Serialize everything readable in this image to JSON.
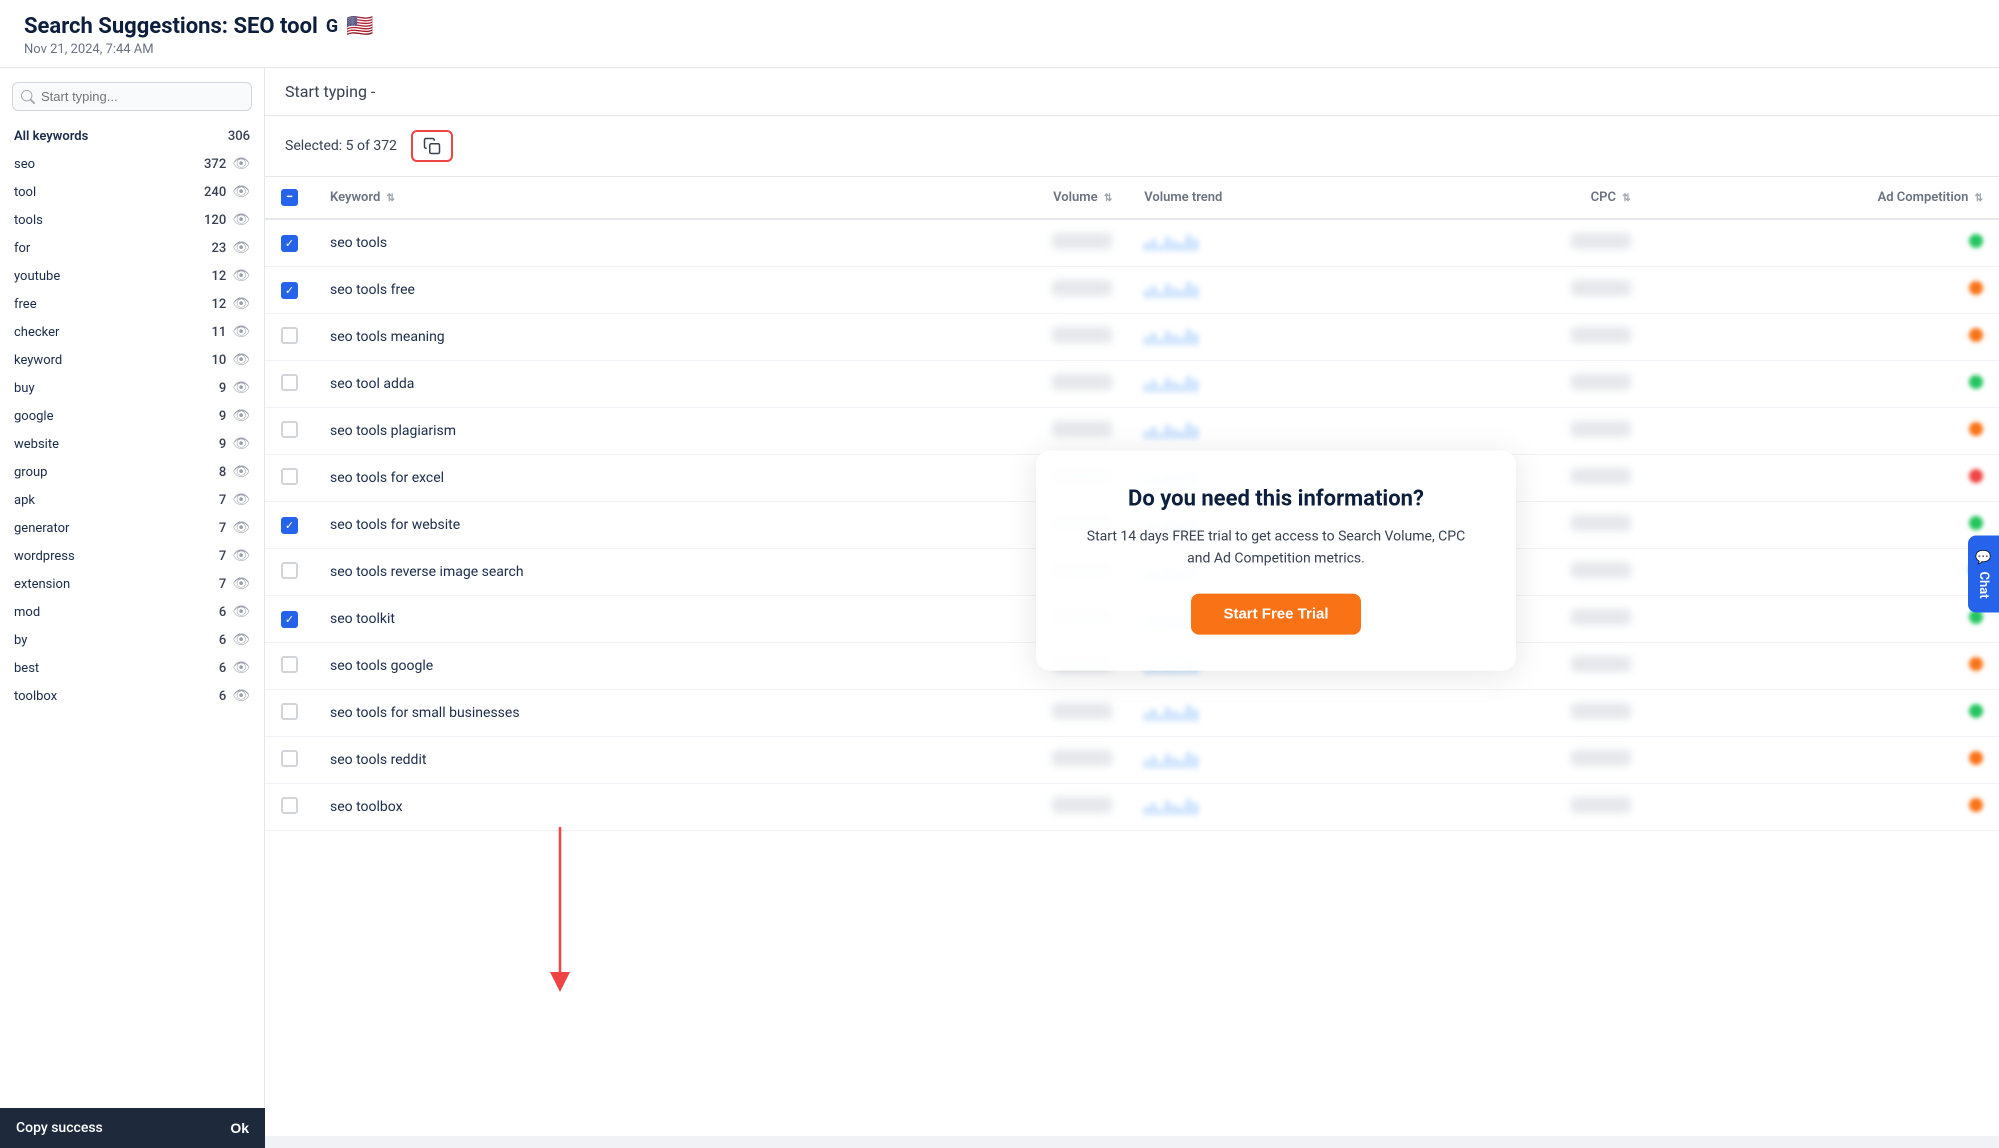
{
  "header": {
    "title": "Search Suggestions: SEO tool",
    "subtitle": "Nov 21, 2024, 7:44 AM",
    "google_icon": "G",
    "flag": "🇺🇸"
  },
  "toolbar": {
    "selected_label": "Selected: 5 of 372",
    "copy_btn_icon": "📋"
  },
  "hint": {
    "text": "Start typing -"
  },
  "sidebar": {
    "search_placeholder": "Start typing...",
    "header_label": "All keywords",
    "header_count": "306",
    "items": [
      {
        "label": "seo",
        "count": "372"
      },
      {
        "label": "tool",
        "count": "240"
      },
      {
        "label": "tools",
        "count": "120"
      },
      {
        "label": "for",
        "count": "23"
      },
      {
        "label": "youtube",
        "count": "12"
      },
      {
        "label": "free",
        "count": "12"
      },
      {
        "label": "checker",
        "count": "11"
      },
      {
        "label": "keyword",
        "count": "10"
      },
      {
        "label": "buy",
        "count": "9"
      },
      {
        "label": "google",
        "count": "9"
      },
      {
        "label": "website",
        "count": "9"
      },
      {
        "label": "group",
        "count": "8"
      },
      {
        "label": "apk",
        "count": "7"
      },
      {
        "label": "generator",
        "count": "7"
      },
      {
        "label": "wordpress",
        "count": "7"
      },
      {
        "label": "extension",
        "count": "7"
      },
      {
        "label": "mod",
        "count": "6"
      },
      {
        "label": "by",
        "count": "6"
      },
      {
        "label": "best",
        "count": "6"
      },
      {
        "label": "toolbox",
        "count": "6"
      }
    ]
  },
  "table": {
    "columns": [
      "Keyword",
      "Volume",
      "Volume trend",
      "CPC",
      "Ad Competition"
    ],
    "rows": [
      {
        "keyword": "seo tools",
        "checked": true
      },
      {
        "keyword": "seo tools free",
        "checked": true
      },
      {
        "keyword": "seo tools meaning",
        "checked": false
      },
      {
        "keyword": "seo tool adda",
        "checked": false
      },
      {
        "keyword": "seo tools plagiarism",
        "checked": false
      },
      {
        "keyword": "seo tools for excel",
        "checked": false
      },
      {
        "keyword": "seo tools for website",
        "checked": true
      },
      {
        "keyword": "seo tools reverse image search",
        "checked": false
      },
      {
        "keyword": "seo toolkit",
        "checked": true
      },
      {
        "keyword": "seo tools google",
        "checked": false
      },
      {
        "keyword": "seo tools for small businesses",
        "checked": false
      },
      {
        "keyword": "seo tools reddit",
        "checked": false
      },
      {
        "keyword": "seo toolbox",
        "checked": false
      }
    ],
    "ad_colors": [
      "green",
      "orange",
      "orange",
      "green",
      "orange",
      "red",
      "green",
      "green",
      "green",
      "orange",
      "green",
      "orange",
      "orange"
    ]
  },
  "upsell": {
    "title": "Do you need this information?",
    "body": "Start 14 days FREE trial to get access to Search Volume, CPC and Ad Competition metrics.",
    "cta": "Start Free Trial"
  },
  "toast": {
    "message": "Copy success",
    "ok_label": "Ok"
  },
  "chat_widget": {
    "label": "Chat"
  }
}
